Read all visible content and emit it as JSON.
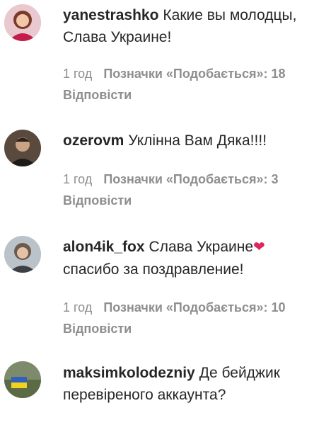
{
  "comments": [
    {
      "username": "yanestrashko",
      "text_line1": "Какие вы молодцы,",
      "text_line2": "Слава Украине!",
      "time": "1 год",
      "likes": "Позначки «Подобається»: 18",
      "reply": "Відповісти"
    },
    {
      "username": "ozerovm",
      "text_line1": "Уклінна Вам Дяка!!!!",
      "time": "1 год",
      "likes": "Позначки «Подобається»: 3",
      "reply": "Відповісти"
    },
    {
      "username": "alon4ik_fox",
      "text_line1": "Слава Украине",
      "heart": "❤",
      "text_line2": "спасибо за поздравление!",
      "time": "1 год",
      "likes": "Позначки «Подобається»: 10",
      "reply": "Відповісти"
    },
    {
      "username": "maksimkolodezniy",
      "text_line1": "Де бейджик",
      "text_line2": "перевіреного аккаунта?"
    }
  ],
  "colors": {
    "text": "#262626",
    "meta": "#8e8e8e",
    "heart": "#e0245e"
  }
}
